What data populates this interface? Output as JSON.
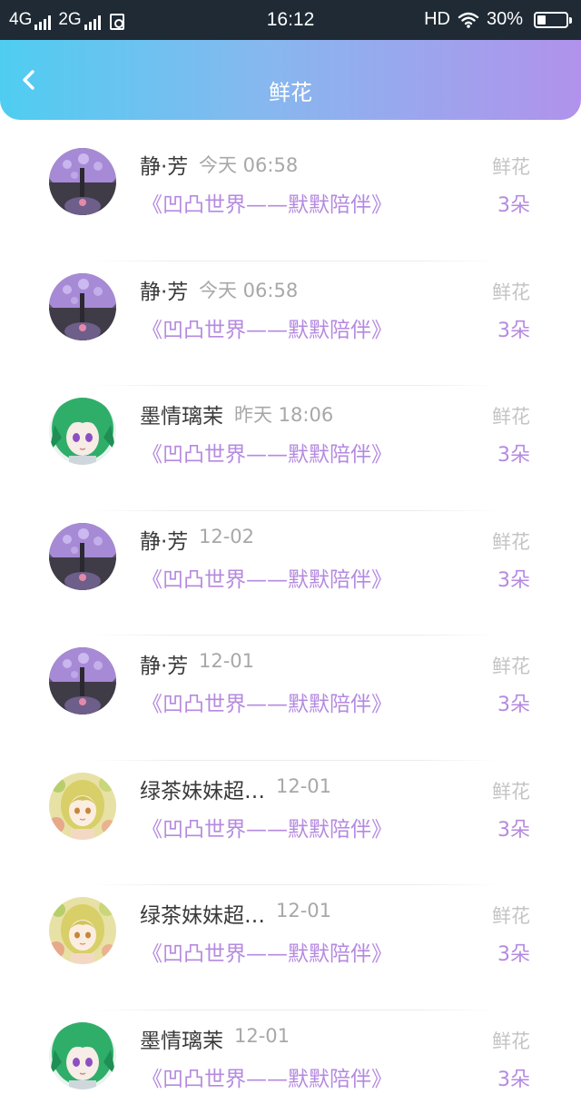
{
  "status_bar": {
    "net1": "4G",
    "net2": "2G",
    "time": "16:12",
    "hd": "HD",
    "battery": "30%",
    "battery_level": 0.3,
    "icons": [
      "signal-bars-icon",
      "sim-icon",
      "wifi-icon",
      "battery-icon"
    ]
  },
  "header": {
    "title": "鲜花",
    "back_icon": "chevron-left-icon",
    "colors": {
      "gradient_start": "#4fcdf1",
      "gradient_end": "#b192ec"
    }
  },
  "colors": {
    "accent": "#b58ae0",
    "muted": "#a8a8a8",
    "name": "#3a3a3a"
  },
  "records": [
    {
      "user": "静·芳",
      "time": "今天 06:58",
      "room": "《凹凸世界——默默陪伴》",
      "gift": "鲜花",
      "count": "3朵",
      "avatar": "avatar-purple-umbrella"
    },
    {
      "user": "静·芳",
      "time": "今天 06:58",
      "room": "《凹凸世界——默默陪伴》",
      "gift": "鲜花",
      "count": "3朵",
      "avatar": "avatar-purple-umbrella"
    },
    {
      "user": "墨情璃茉",
      "time": "昨天 18:06",
      "room": "《凹凸世界——默默陪伴》",
      "gift": "鲜花",
      "count": "3朵",
      "avatar": "avatar-green-hair"
    },
    {
      "user": "静·芳",
      "time": "12-02",
      "room": "《凹凸世界——默默陪伴》",
      "gift": "鲜花",
      "count": "3朵",
      "avatar": "avatar-purple-umbrella"
    },
    {
      "user": "静·芳",
      "time": "12-01",
      "room": "《凹凸世界——默默陪伴》",
      "gift": "鲜花",
      "count": "3朵",
      "avatar": "avatar-purple-umbrella"
    },
    {
      "user": "绿茶妹妹超…",
      "time": "12-01",
      "room": "《凹凸世界——默默陪伴》",
      "gift": "鲜花",
      "count": "3朵",
      "avatar": "avatar-yellow-girl"
    },
    {
      "user": "绿茶妹妹超…",
      "time": "12-01",
      "room": "《凹凸世界——默默陪伴》",
      "gift": "鲜花",
      "count": "3朵",
      "avatar": "avatar-yellow-girl"
    },
    {
      "user": "墨情璃茉",
      "time": "12-01",
      "room": "《凹凸世界——默默陪伴》",
      "gift": "鲜花",
      "count": "3朵",
      "avatar": "avatar-green-hair"
    }
  ]
}
